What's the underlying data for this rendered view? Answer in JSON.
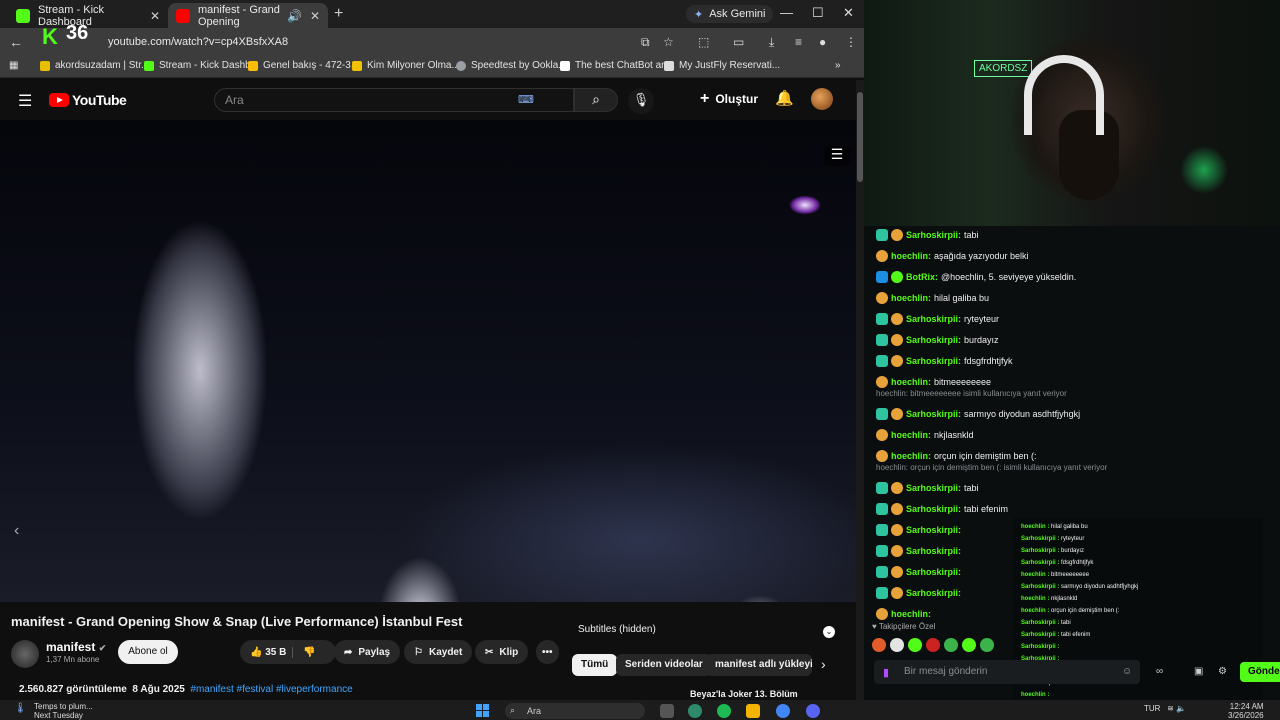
{
  "browser": {
    "tabs": [
      {
        "title": "Stream - Kick Dashboard"
      },
      {
        "title": "manifest - Grand Opening"
      }
    ],
    "new_tab_glyph": "+",
    "ask_gemini": "Ask Gemini",
    "url": "youtube.com/watch?v=cp4XBsfxXA8",
    "kick_logo": "K",
    "kick_count": "36",
    "bookmarks": [
      {
        "label": "akordsuzadam | Str...",
        "color": "#e8c000"
      },
      {
        "label": "Stream - Kick Dashb...",
        "color": "#53fc18"
      },
      {
        "label": "Genel bakış - 472-3...",
        "color": "#fbbc04"
      },
      {
        "label": "Kim Milyoner Olma...",
        "color": "#f2c200"
      },
      {
        "label": "Speedtest by Ookla...",
        "color": "#9aa0a6"
      },
      {
        "label": "The best ChatBot an...",
        "color": "#ffffff"
      },
      {
        "label": "My JustFly Reservati...",
        "color": "#dddddd"
      }
    ]
  },
  "youtube": {
    "logo": "YouTube",
    "search_placeholder": "Ara",
    "create_label": "Oluştur",
    "video": {
      "title": "manifest - Grand Opening Show & Snap (Live Performance) İstanbul Fest",
      "channel": "manifest",
      "subscribers": "1,37 Mn abone",
      "subscribe": "Abone ol",
      "likes": "35 B",
      "share": "Paylaş",
      "save": "Kaydet",
      "clip": "Klip",
      "views": "2.560.827 görüntüleme",
      "date": "8 Ağu 2025",
      "tags": "#manifest #festival #liveperformance"
    },
    "side": {
      "subtitles": "Subtitles (hidden)",
      "chips": [
        "Tümü",
        "Seriden videolar",
        "manifest adlı yükleyi"
      ],
      "next_video": "Beyaz'la Joker 13. Bölüm"
    }
  },
  "stream": {
    "sign": "AKORDSZ"
  },
  "chat": {
    "messages": [
      {
        "user": "Sarhoskirpii:",
        "text": "tabi",
        "color": "#53fc18",
        "reply": false
      },
      {
        "user": "hoechlin:",
        "text": "aşağıda yazıyodur belki",
        "color": "#53fc18"
      },
      {
        "user": "BotRix:",
        "text": "@hoechlin, 5. seviyeye yükseldin.",
        "color": "#53fc18"
      },
      {
        "user": "hoechlin:",
        "text": "hilal galiba bu",
        "color": "#53fc18"
      },
      {
        "user": "Sarhoskirpii:",
        "text": "ryteyteur",
        "color": "#53fc18"
      },
      {
        "user": "Sarhoskirpii:",
        "text": "burdayız",
        "color": "#53fc18"
      },
      {
        "user": "Sarhoskirpii:",
        "text": "fdsgfrdhtjfyk",
        "color": "#53fc18"
      },
      {
        "user": "hoechlin:",
        "text": "bitmeeeeeeee",
        "color": "#53fc18"
      },
      {
        "user": "Sarhoskirpii:",
        "text": "sarmıyo diyodun asdhtfjyhgkj",
        "color": "#53fc18"
      },
      {
        "user": "hoechlin:",
        "text": "nkjlasnkld",
        "color": "#53fc18"
      },
      {
        "user": "hoechlin:",
        "text": "orçun için demiştim ben (:",
        "color": "#53fc18"
      },
      {
        "user": "Sarhoskirpii:",
        "text": "tabi",
        "color": "#53fc18"
      },
      {
        "user": "Sarhoskirpii:",
        "text": "tabi efenim",
        "color": "#53fc18"
      },
      {
        "user": "Sarhoskirpii:",
        "text": "",
        "color": "#53fc18"
      },
      {
        "user": "Sarhoskirpii:",
        "text": "",
        "color": "#53fc18"
      },
      {
        "user": "Sarhoskirpii:",
        "text": "",
        "color": "#53fc18"
      },
      {
        "user": "Sarhoskirpii:",
        "text": "",
        "color": "#53fc18"
      },
      {
        "user": "hoechlin:",
        "text": "",
        "color": "#53fc18"
      }
    ],
    "replies": [
      "hoechlin: bitmeeeeeeee isimli kullanıcıya yanıt veriyor",
      "hoechlin: orçun için demiştim ben (: isimli kullanıcıya yanıt veriyor"
    ],
    "mini": [
      {
        "u": "hoechlin :",
        "t": "hilal galiba bu"
      },
      {
        "u": "Sarhoskirpii :",
        "t": "ryteyteur"
      },
      {
        "u": "Sarhoskirpii :",
        "t": "burdayız"
      },
      {
        "u": "Sarhoskirpii :",
        "t": "fdsgfrdhtjfyk"
      },
      {
        "u": "hoechlin :",
        "t": "bitmeeeeeeee"
      },
      {
        "u": "Sarhoskirpii :",
        "t": "sarmıyo diyodun asdhtfjyhgkj"
      },
      {
        "u": "hoechlin :",
        "t": "nkjlasnkld"
      },
      {
        "u": "hoechlin :",
        "t": "orçun için demiştim ben (:"
      },
      {
        "u": "Sarhoskirpii :",
        "t": "tabi"
      },
      {
        "u": "Sarhoskirpii :",
        "t": "tabi efenim"
      },
      {
        "u": "Sarhoskirpii :",
        "t": ""
      },
      {
        "u": "Sarhoskirpii :",
        "t": ""
      },
      {
        "u": "Sarhoskirpii :",
        "t": ""
      },
      {
        "u": "Sarhoskirpii :",
        "t": ""
      },
      {
        "u": "hoechlin :",
        "t": ""
      }
    ],
    "followers_label": "Takipçilere Özel",
    "input_placeholder": "Bir mesaj gönderin",
    "send": "Gönder"
  },
  "taskbar": {
    "weather_line1": "Temps to plum...",
    "weather_line2": "Next Tuesday",
    "search": "Ara",
    "lang": "TUR",
    "time": "12:24 AM",
    "date": "3/26/2026"
  }
}
